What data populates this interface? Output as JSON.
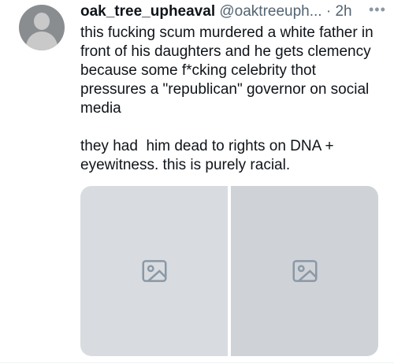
{
  "tweet": {
    "display_name": "oak_tree_upheaval",
    "handle": "@oaktreeuph...",
    "separator": "·",
    "timestamp": "2h",
    "more_icon": "more-horizontal-icon",
    "text": "this fucking scum murdered a white father in front of his daughters and he gets clemency because some f*cking celebrity thot pressures a \"republican\" governor on social media\n\nthey had  him dead to rights on DNA + eyewitness. this is purely racial."
  },
  "media": {
    "count": 2,
    "icons": [
      "image-placeholder-icon",
      "image-placeholder-icon"
    ]
  },
  "colors": {
    "text": "#0f1419",
    "secondary": "#536471",
    "placeholder": "#d8dce0"
  }
}
